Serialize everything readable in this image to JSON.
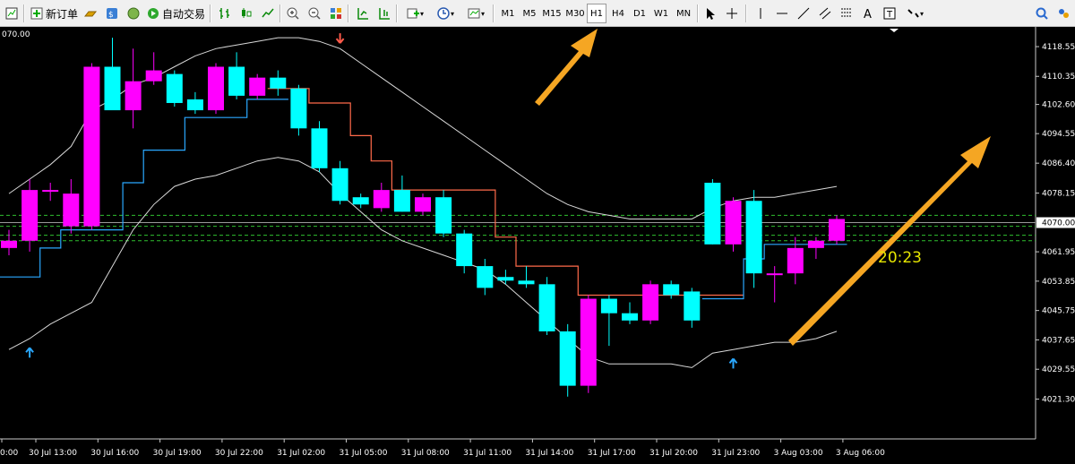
{
  "toolbar": {
    "new_order_label": "新订单",
    "auto_trading_label": "自动交易",
    "timeframes": [
      "M1",
      "M5",
      "M15",
      "M30",
      "H1",
      "H4",
      "D1",
      "W1",
      "MN"
    ],
    "active_timeframe": "H1"
  },
  "chart_data": {
    "type": "candlestick",
    "title": "",
    "top_left_price": "070.00",
    "current_price_label": "4070.00",
    "countdown": "20:23",
    "ylim": [
      4017,
      4124
    ],
    "y_ticks": [
      "4118.55",
      "4110.35",
      "4102.60",
      "4094.55",
      "4086.40",
      "4078.15",
      "4061.95",
      "4053.85",
      "4045.75",
      "4037.65",
      "4029.55",
      "4021.30"
    ],
    "x_ticks": [
      "0:00",
      "30 Jul 13:00",
      "30 Jul 16:00",
      "30 Jul 19:00",
      "30 Jul 22:00",
      "31 Jul 02:00",
      "31 Jul 05:00",
      "31 Jul 08:00",
      "31 Jul 11:00",
      "31 Jul 14:00",
      "31 Jul 17:00",
      "31 Jul 20:00",
      "31 Jul 23:00",
      "3 Aug 03:00",
      "3 Aug 06:00"
    ],
    "candles": [
      {
        "o": 4063,
        "h": 4068,
        "l": 4061,
        "c": 4065
      },
      {
        "o": 4065,
        "h": 4082,
        "l": 4062,
        "c": 4079
      },
      {
        "o": 4079,
        "h": 4081,
        "l": 4076,
        "c": 4079
      },
      {
        "o": 4069,
        "h": 4082,
        "l": 4067,
        "c": 4078
      },
      {
        "o": 4069,
        "h": 4114,
        "l": 4068,
        "c": 4113
      },
      {
        "o": 4113,
        "h": 4121,
        "l": 4103,
        "c": 4101
      },
      {
        "o": 4101,
        "h": 4118,
        "l": 4096,
        "c": 4109
      },
      {
        "o": 4109,
        "h": 4117,
        "l": 4108,
        "c": 4112
      },
      {
        "o": 4111,
        "h": 4112,
        "l": 4102,
        "c": 4103
      },
      {
        "o": 4104,
        "h": 4106,
        "l": 4100,
        "c": 4101
      },
      {
        "o": 4101,
        "h": 4114,
        "l": 4100,
        "c": 4113
      },
      {
        "o": 4113,
        "h": 4117,
        "l": 4104,
        "c": 4105
      },
      {
        "o": 4105,
        "h": 4111,
        "l": 4104,
        "c": 4110
      },
      {
        "o": 4110,
        "h": 4112,
        "l": 4105,
        "c": 4107
      },
      {
        "o": 4107,
        "h": 4108,
        "l": 4094,
        "c": 4096
      },
      {
        "o": 4096,
        "h": 4098,
        "l": 4084,
        "c": 4085
      },
      {
        "o": 4085,
        "h": 4087,
        "l": 4075,
        "c": 4076
      },
      {
        "o": 4077,
        "h": 4078,
        "l": 4074,
        "c": 4075
      },
      {
        "o": 4074,
        "h": 4081,
        "l": 4073,
        "c": 4079
      },
      {
        "o": 4079,
        "h": 4083,
        "l": 4073,
        "c": 4073
      },
      {
        "o": 4073,
        "h": 4078,
        "l": 4072,
        "c": 4077
      },
      {
        "o": 4077,
        "h": 4079,
        "l": 4066,
        "c": 4067
      },
      {
        "o": 4067,
        "h": 4068,
        "l": 4056,
        "c": 4058
      },
      {
        "o": 4058,
        "h": 4060,
        "l": 4050,
        "c": 4052
      },
      {
        "o": 4055,
        "h": 4057,
        "l": 4053,
        "c": 4054
      },
      {
        "o": 4054,
        "h": 4058,
        "l": 4052,
        "c": 4053
      },
      {
        "o": 4053,
        "h": 4055,
        "l": 4039,
        "c": 4040
      },
      {
        "o": 4040,
        "h": 4042,
        "l": 4022,
        "c": 4025
      },
      {
        "o": 4025,
        "h": 4050,
        "l": 4023,
        "c": 4049
      },
      {
        "o": 4049,
        "h": 4050,
        "l": 4036,
        "c": 4045
      },
      {
        "o": 4045,
        "h": 4048,
        "l": 4042,
        "c": 4043
      },
      {
        "o": 4043,
        "h": 4054,
        "l": 4042,
        "c": 4053
      },
      {
        "o": 4053,
        "h": 4054,
        "l": 4049,
        "c": 4050
      },
      {
        "o": 4051,
        "h": 4052,
        "l": 4041,
        "c": 4043
      },
      {
        "o": 4081,
        "h": 4082,
        "l": 4064,
        "c": 4064
      },
      {
        "o": 4064,
        "h": 4077,
        "l": 4062,
        "c": 4076
      },
      {
        "o": 4076,
        "h": 4079,
        "l": 4052,
        "c": 4056
      },
      {
        "o": 4056,
        "h": 4058,
        "l": 4048,
        "c": 4056
      },
      {
        "o": 4056,
        "h": 4066,
        "l": 4053,
        "c": 4063
      },
      {
        "o": 4063,
        "h": 4066,
        "l": 4060,
        "c": 4065
      },
      {
        "o": 4065,
        "h": 4072,
        "l": 4064,
        "c": 4071
      }
    ],
    "upper_band": [
      4078,
      4082,
      4086,
      4091,
      4101,
      4104,
      4108,
      4110,
      4113,
      4116,
      4118,
      4119,
      4120,
      4121,
      4121,
      4120,
      4118,
      4114,
      4110,
      4106,
      4102,
      4098,
      4094,
      4090,
      4086,
      4082,
      4078,
      4075,
      4073,
      4072,
      4071,
      4071,
      4071,
      4071,
      4074,
      4076,
      4077,
      4077,
      4078,
      4079,
      4080
    ],
    "lower_band": [
      4035,
      4038,
      4042,
      4045,
      4048,
      4058,
      4068,
      4075,
      4080,
      4082,
      4083,
      4085,
      4087,
      4088,
      4087,
      4084,
      4078,
      4073,
      4068,
      4065,
      4063,
      4061,
      4059,
      4057,
      4053,
      4048,
      4043,
      4038,
      4033,
      4031,
      4031,
      4031,
      4031,
      4030,
      4034,
      4035,
      4036,
      4037,
      4037,
      4038,
      4040
    ],
    "red_line_start": 13,
    "red_line": [
      4107,
      4107,
      4103,
      4103,
      4094,
      4087,
      4079,
      4079,
      4079,
      4079,
      4079,
      4066,
      4058,
      4058,
      4058,
      4050,
      4050,
      4050,
      4050,
      4050,
      4050,
      4050,
      4050
    ],
    "blue_line": [
      4055,
      4055,
      4063,
      4068,
      4068,
      4068,
      4081,
      4090,
      4090,
      4099,
      4099,
      4099,
      4104,
      4104
    ],
    "blue_line2": [
      4049,
      4049,
      4060,
      4064,
      4064,
      4064,
      4064
    ],
    "dotted_levels": [
      4072,
      4069,
      4066.5,
      4065
    ],
    "arrows": [
      {
        "i": 1,
        "price": 4034,
        "dir": "up"
      },
      {
        "i": 16,
        "price": 4121,
        "dir": "down"
      },
      {
        "i": 35,
        "price": 4031,
        "dir": "up"
      }
    ]
  }
}
